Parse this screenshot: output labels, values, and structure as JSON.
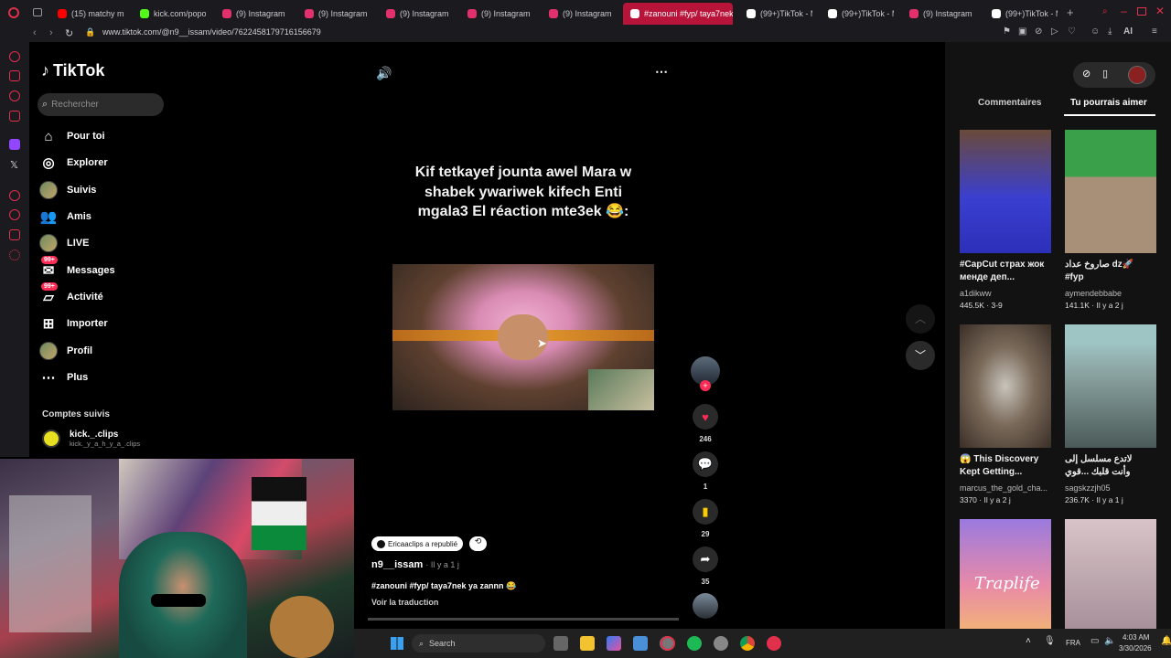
{
  "browser": {
    "tabs": [
      {
        "label": "(15) matchy mat",
        "color": "#ff0000"
      },
      {
        "label": "kick.com/popou",
        "color": "#53fc18"
      },
      {
        "label": "(9) Instagram",
        "color": "#e1306c"
      },
      {
        "label": "(9) Instagram",
        "color": "#e1306c"
      },
      {
        "label": "(9) Instagram",
        "color": "#e1306c"
      },
      {
        "label": "(9) Instagram",
        "color": "#e1306c"
      },
      {
        "label": "(9) Instagram",
        "color": "#e1306c"
      },
      {
        "label": "#zanouni #fyp/ taya7nek",
        "color": "#ffffff"
      },
      {
        "label": "(99+)TikTok - M",
        "color": "#ffffff"
      },
      {
        "label": "(99+)TikTok - M",
        "color": "#ffffff"
      },
      {
        "label": "(9) Instagram",
        "color": "#e1306c"
      },
      {
        "label": "(99+)TikTok - M",
        "color": "#ffffff"
      }
    ],
    "url": "www.tiktok.com/@n9__issam/video/7622458179716156679",
    "ai_label": "AI"
  },
  "tiktok": {
    "logo": "TikTok",
    "search_placeholder": "Rechercher",
    "nav": [
      {
        "label": "Pour toi",
        "icon": "home-icon"
      },
      {
        "label": "Explorer",
        "icon": "compass-icon"
      },
      {
        "label": "Suivis",
        "icon": "avatar"
      },
      {
        "label": "Amis",
        "icon": "friends-icon"
      },
      {
        "label": "LIVE",
        "icon": "avatar"
      },
      {
        "label": "Messages",
        "icon": "message-icon",
        "badge": "99+"
      },
      {
        "label": "Activité",
        "icon": "inbox-icon",
        "badge": "99+"
      },
      {
        "label": "Importer",
        "icon": "plus-square-icon"
      },
      {
        "label": "Profil",
        "icon": "avatar"
      },
      {
        "label": "Plus",
        "icon": "more-icon"
      }
    ],
    "following_title": "Comptes suivis",
    "following": {
      "name": "kick._.clips",
      "handle": "kick._y_a_h_y_a_.clips"
    }
  },
  "video": {
    "caption": "Kif tetkayef jounta awel Mara w shabek ywariwek kifech Enti mgala3 El réaction mte3ek 😂:",
    "repost_label": "Ericaaclips a republié",
    "author": "n9__issam",
    "time": "Il y a 1 j",
    "description": "#zanouni #fyp/ taya7nek ya zannn 😂",
    "translate": "Voir la traduction",
    "likes": "246",
    "comments": "1",
    "saves": "29",
    "shares": "35"
  },
  "right_panel": {
    "tabs": [
      "Commentaires",
      "Tu pourrais aimer"
    ],
    "cards": [
      {
        "title": "#CapCut страх жок менде деп...",
        "user": "a1dikww",
        "stat": "445.5K · 3-9"
      },
      {
        "title": "صاروخ عداد dz🚀 #fyp",
        "user": "aymendebbabe",
        "stat": "141.1K · Il y a 2 j"
      },
      {
        "title": "😱 This Discovery Kept Getting...",
        "user": "marcus_the_gold_cha...",
        "stat": "3370 · Il y a 2 j"
      },
      {
        "title": "لاتدع مسلسل إلى وأنت قلبك ...قوي",
        "user": "sagskzzjh05",
        "stat": "236.7K · Il y a 1 j"
      }
    ],
    "watermark": "Traplife"
  },
  "taskbar": {
    "search": "Search",
    "lang": "FRA",
    "time": "4:03 AM",
    "date": "3/30/2026"
  }
}
